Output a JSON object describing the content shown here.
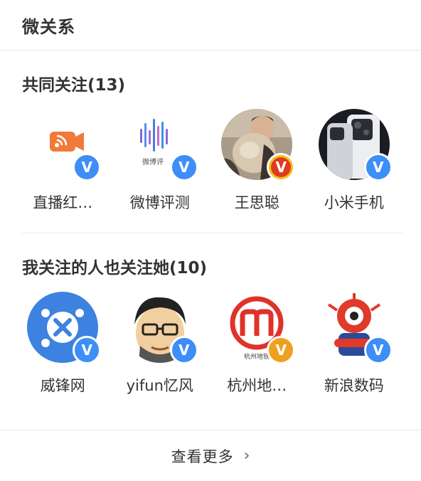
{
  "header": {
    "title": "微关系"
  },
  "common_follows": {
    "title": "共同关注(13)",
    "users": [
      {
        "name": "直播红…",
        "avatar": "live-stream-logo",
        "badge_color": "#3d8ef7"
      },
      {
        "name": "微博评测",
        "avatar": "weibo-review-logo",
        "badge_color": "#3d8ef7"
      },
      {
        "name": "王思聪",
        "avatar": "person-photo",
        "badge_color": "#e03a1f"
      },
      {
        "name": "小米手机",
        "avatar": "phone-photo",
        "badge_color": "#3d8ef7"
      }
    ]
  },
  "also_follow": {
    "title": "我关注的人也关注她(10)",
    "users": [
      {
        "name": "威锋网",
        "avatar": "weiphone-logo",
        "badge_color": "#3d8ef7"
      },
      {
        "name": "yifun忆风",
        "avatar": "cartoon-face",
        "badge_color": "#3d8ef7"
      },
      {
        "name": "杭州地…",
        "avatar": "metro-logo",
        "badge_color": "#f0a020"
      },
      {
        "name": "新浪数码",
        "avatar": "sina-mascot",
        "badge_color": "#3d8ef7"
      }
    ]
  },
  "badge_symbol": "V",
  "footer": {
    "more_label": "查看更多",
    "chevron": "›"
  }
}
